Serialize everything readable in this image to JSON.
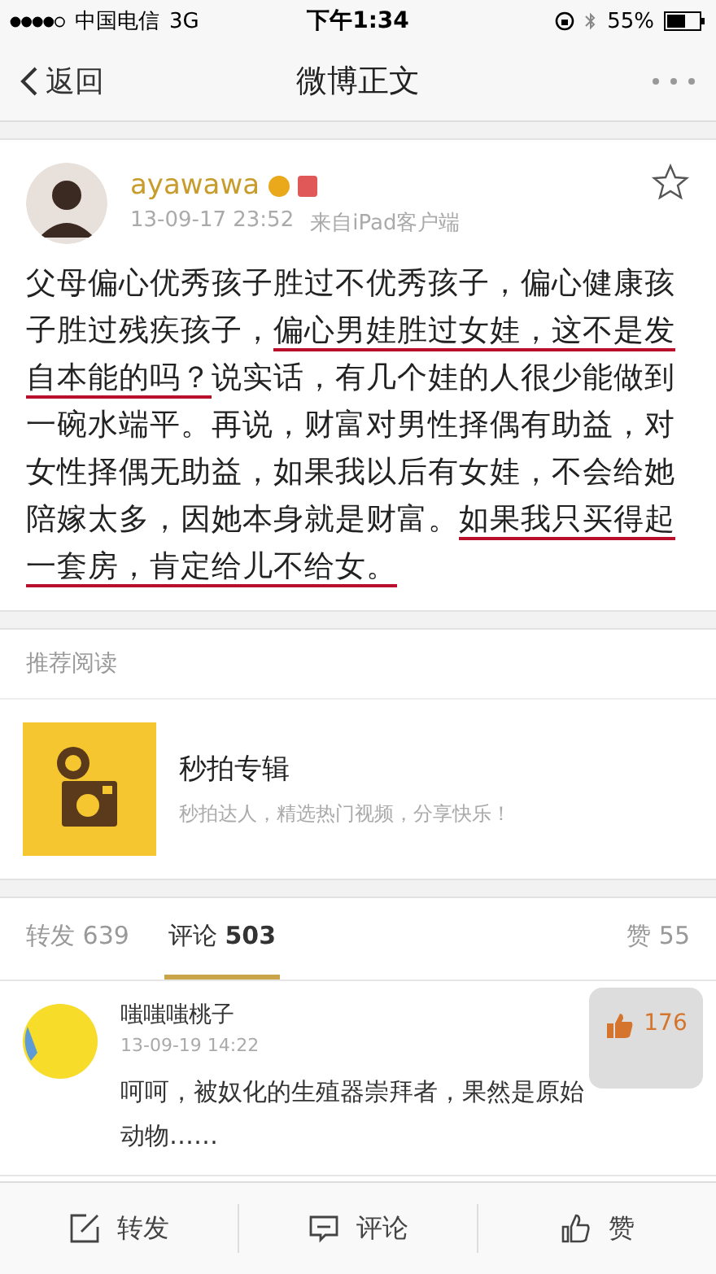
{
  "status_bar": {
    "carrier": "中国电信",
    "network": "3G",
    "time": "下午1:34",
    "battery": "55%"
  },
  "nav": {
    "back": "返回",
    "title": "微博正文"
  },
  "post": {
    "author": "ayawawa",
    "time": "13-09-17 23:52",
    "source": "来自iPad客户端",
    "starred": false,
    "segments": [
      {
        "text": "父母偏心优秀孩子胜过不优秀孩子，偏心健康孩子胜过残疾孩子，",
        "underlined": false
      },
      {
        "text": "偏心男娃胜过女娃，这不是发自本能的吗？",
        "underlined": true
      },
      {
        "text": "说实话，有几个娃的人很少能做到一碗水端平。再说，财富对男性择偶有助益，对女性择偶无助益，如果我以后有女娃，不会给她陪嫁太多，因她本身就是财富。",
        "underlined": false
      },
      {
        "text": "如果我只买得起一套房，肯定给儿不给女。",
        "underlined": true
      }
    ]
  },
  "recommend": {
    "heading": "推荐阅读",
    "title": "秒拍专辑",
    "subtitle": "秒拍达人，精选热门视频，分享快乐！"
  },
  "tabs": [
    {
      "label": "转发",
      "count": "639",
      "selected": false
    },
    {
      "label": "评论",
      "count": "503",
      "selected": true
    },
    {
      "label": "赞",
      "count": "55",
      "selected": false
    }
  ],
  "comments": [
    {
      "author": "嗤嗤嗤桃子",
      "time": "13-09-19 14:22",
      "likes": "176",
      "text": "呵呵，被奴化的生殖器崇拜者，果然是原始动物……"
    }
  ],
  "toolbar": [
    {
      "kind": "repost",
      "label": "转发"
    },
    {
      "kind": "comment",
      "label": "评论"
    },
    {
      "kind": "like",
      "label": "赞"
    }
  ]
}
